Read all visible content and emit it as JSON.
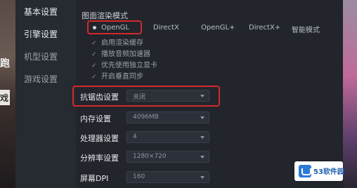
{
  "background": {
    "left_chars": [
      "跑",
      "戏"
    ]
  },
  "sidebar": {
    "items": [
      {
        "label": "基本设置"
      },
      {
        "label": "引擎设置"
      },
      {
        "label": "机型设置"
      },
      {
        "label": "游戏设置"
      }
    ]
  },
  "render": {
    "title": "图面渲染模式",
    "modes": [
      {
        "label": "OpenGL",
        "selected": true
      },
      {
        "label": "DirectX"
      },
      {
        "label": "OpenGL+"
      },
      {
        "label": "DirectX+"
      },
      {
        "label": "智能模式"
      }
    ],
    "options": [
      {
        "label": "启用渲染缓存"
      },
      {
        "label": "播放音频加速器"
      },
      {
        "label": "优先使用独立显卡"
      },
      {
        "label": "开启垂直同步"
      }
    ]
  },
  "settings": {
    "antialias": {
      "label": "抗锯齿设置",
      "value": "关闭"
    },
    "memory": {
      "label": "内存设置",
      "value": "4096MB"
    },
    "cpu": {
      "label": "处理器设置",
      "value": "4"
    },
    "resolution": {
      "label": "分辨率设置",
      "value": "1280×720"
    },
    "dpi": {
      "label": "屏幕DPI",
      "value": "160"
    }
  },
  "watermark": {
    "text": "53软件园"
  },
  "colors": {
    "highlight": "#d2292c",
    "panel": "#22252b",
    "sidebar": "#262a31"
  }
}
